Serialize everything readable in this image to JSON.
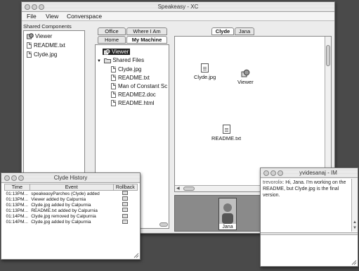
{
  "main_window": {
    "title": "Speakeasy - XC",
    "menu": [
      "File",
      "View",
      "Converspace"
    ],
    "shared_components": {
      "label": "Shared Components",
      "items": [
        {
          "icon": "viewer-icon",
          "label": "Viewer"
        },
        {
          "icon": "document-icon",
          "label": "README.txt"
        },
        {
          "icon": "document-icon",
          "label": "Clyde.jpg"
        }
      ]
    },
    "place_tabs": {
      "row1": [
        "Office",
        "Where I Am"
      ],
      "row2": [
        "Home",
        "My Machine"
      ],
      "active": "My Machine"
    },
    "tree": {
      "viewer": "Viewer",
      "shared_files_label": "Shared Files",
      "files": [
        "Clyde.jpg",
        "README.txt",
        "Man of Constant Sc",
        "README2.doc",
        "README.html"
      ]
    },
    "person_tabs": [
      "Clyde",
      "Jana"
    ],
    "workspace_icons": [
      {
        "icon": "document-icon",
        "label": "Clyde.jpg"
      },
      {
        "icon": "viewer-icon",
        "label": "Viewer"
      },
      {
        "icon": "document-icon",
        "label": "README.txt"
      }
    ],
    "participant": {
      "name": "Jana"
    }
  },
  "history_window": {
    "title": "Clyde History",
    "columns": [
      "Time",
      "Event",
      "Rollback"
    ],
    "rows": [
      {
        "time": "01:13PM...",
        "event": "speakeasyParches (Clyde) added"
      },
      {
        "time": "01:13PM...",
        "event": "Viewer added by Calpurnia"
      },
      {
        "time": "01:13PM...",
        "event": "Clyde.jpg added by Calpurnia"
      },
      {
        "time": "01:13PM...",
        "event": "README.txt added by Calpurnia"
      },
      {
        "time": "01:14PM...",
        "event": "Clyde.jpg removed by Calpurnia"
      },
      {
        "time": "01:14PM...",
        "event": "Clyde.jpg added by Calpurnia"
      }
    ]
  },
  "im_window": {
    "title": "yvidesanaj - IM",
    "sender": "trevorolix:",
    "message": "Hi, Jana.  I'm working on the README, but Clyde.jpg is the final version."
  }
}
